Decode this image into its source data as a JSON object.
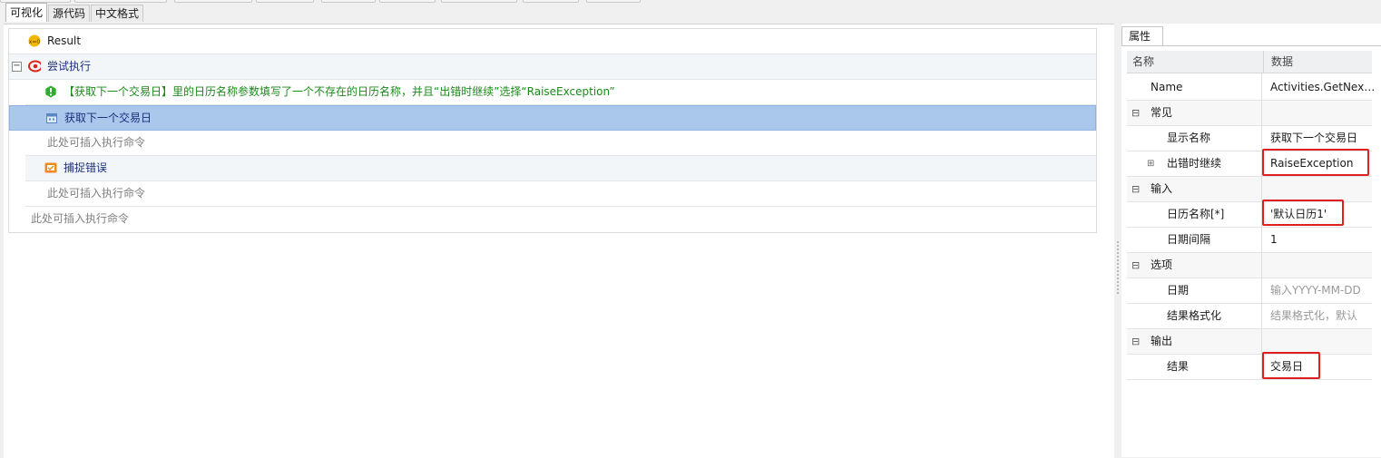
{
  "tabs": [
    "可视化",
    "源代码",
    "中文格式"
  ],
  "workflow": {
    "result_label": "Result",
    "try_label": "尝试执行",
    "warning_text": "【获取下一个交易日】里的日历名称参数填写了一个不存在的日历名称，并且“出错时继续”选择“RaiseException”",
    "activity_label": "获取下一个交易日",
    "insert_hint": "此处可插入执行命令",
    "catch_label": "捕捉错误"
  },
  "properties": {
    "tab_label": "属性",
    "col_name": "名称",
    "col_data": "数据",
    "rows": {
      "name_key": "Name",
      "name_val": "Activities.GetNextTradingDay",
      "common": "常见",
      "display_key": "显示名称",
      "display_val": "获取下一个交易日",
      "continue_key": "出错时继续",
      "continue_val": "RaiseException",
      "input": "输入",
      "calendar_key": "日历名称[*]",
      "calendar_val": "'默认日历1'",
      "interval_key": "日期间隔",
      "interval_val": "1",
      "options": "选项",
      "date_key": "日期",
      "date_placeholder": "输入YYYY-MM-DD",
      "format_key": "结果格式化",
      "format_placeholder": "结果格式化，默认",
      "output": "输出",
      "result_key": "结果",
      "result_val": "交易日"
    }
  },
  "icons": {
    "result": "variable-icon",
    "try": "try-catch-icon",
    "warning": "warning-icon",
    "activity": "calendar-activity-icon",
    "catch": "catch-icon"
  },
  "colors": {
    "selection": "#a9c8ec",
    "warning_text": "#1a8a1a",
    "activity_text": "#1b2f7a",
    "highlight_box": "#e02020"
  }
}
